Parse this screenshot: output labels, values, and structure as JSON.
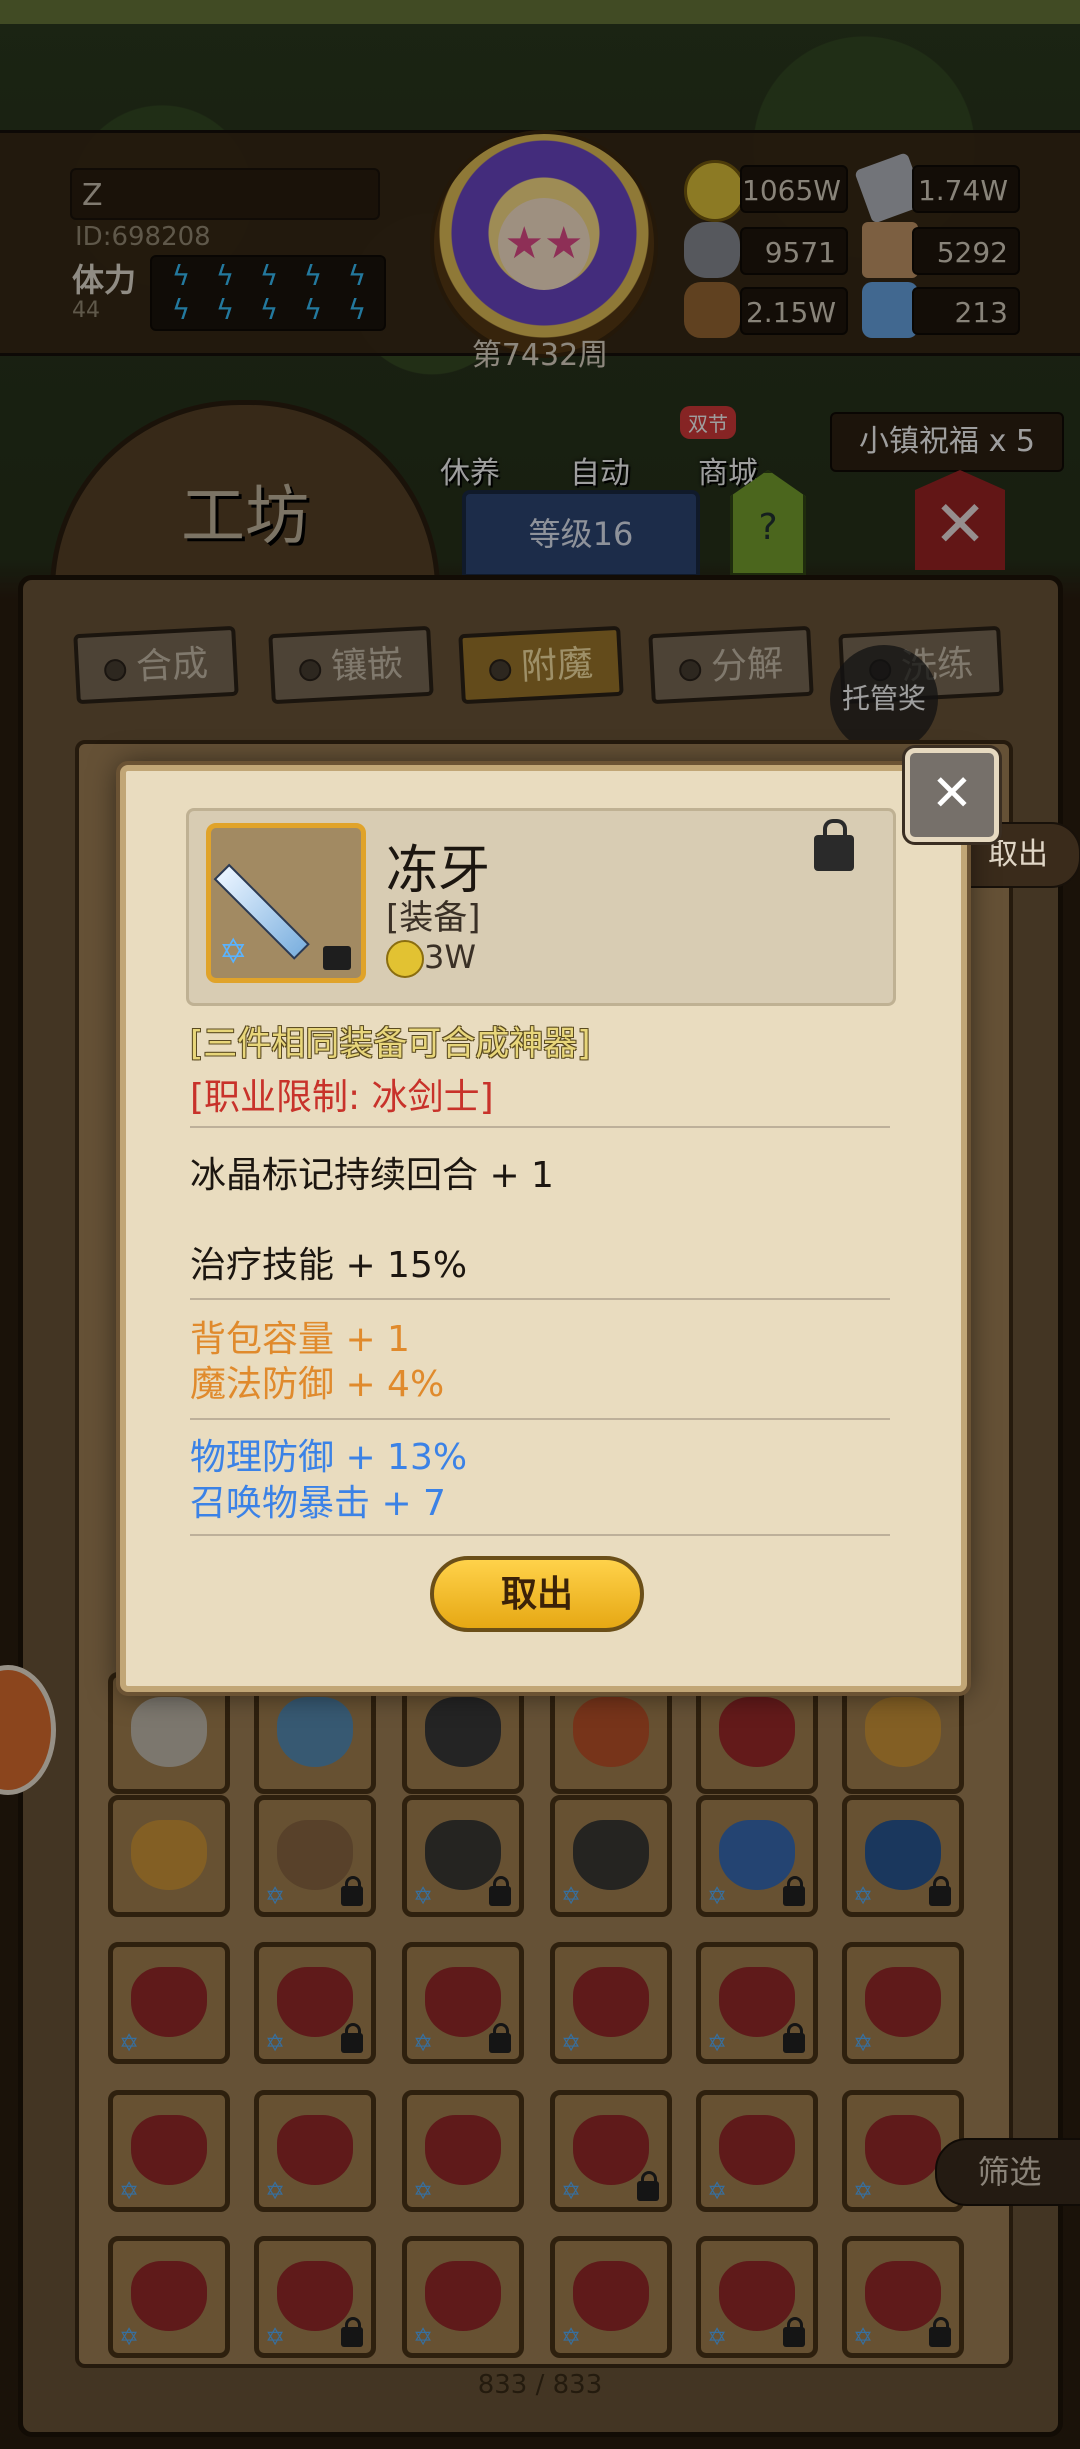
{
  "header": {
    "player_name": "Z",
    "player_id": "ID:698208",
    "stamina_label": "体力",
    "stamina_value": "44",
    "week_label": "第7432周"
  },
  "resources": [
    {
      "icon": "gold-coin-icon",
      "value": "1065W"
    },
    {
      "icon": "silver-ingot-icon",
      "value": "1.74W"
    },
    {
      "icon": "ore-icon",
      "value": "9571"
    },
    {
      "icon": "leather-icon",
      "value": "5292"
    },
    {
      "icon": "wood-log-icon",
      "value": "2.15W"
    },
    {
      "icon": "blue-crystal-icon",
      "value": "213"
    }
  ],
  "nav": {
    "rest_label": "休养",
    "auto_label": "自动",
    "shop_label": "商城",
    "shop_badge": "双节",
    "workshop_label": "工坊",
    "level_label": "等级16",
    "help_label": "?",
    "blessing_label": "小镇祝福 x 5"
  },
  "tabs": [
    {
      "label": "合成",
      "active": false
    },
    {
      "label": "镶嵌",
      "active": false
    },
    {
      "label": "附魔",
      "active": true
    },
    {
      "label": "分解",
      "active": false
    },
    {
      "label": "洗练",
      "active": false
    }
  ],
  "tuoguan_label": "托管奖",
  "side_takeout_label": "取出",
  "filter_label": "筛选",
  "pager": "833 / 833",
  "dialog": {
    "item_name": "冻牙",
    "item_type": "[装备]",
    "item_price": "3W",
    "artifact_hint": "[三件相同装备可合成神器]",
    "class_restriction": "[职业限制: 冰剑士]",
    "stats_white": [
      "冰晶标记持续回合 + 1",
      "治疗技能 + 15%"
    ],
    "stats_orange": [
      "背包容量 + 1",
      "魔法防御 + 4%"
    ],
    "stats_blue": [
      "物理防御 + 13%",
      "召唤物暴击 + 7"
    ],
    "takeout_button": "取出",
    "colors": {
      "hint": "#e8d67a",
      "restriction": "#c8322a",
      "orange": "#e08a2c",
      "blue": "#3b82e6"
    }
  }
}
